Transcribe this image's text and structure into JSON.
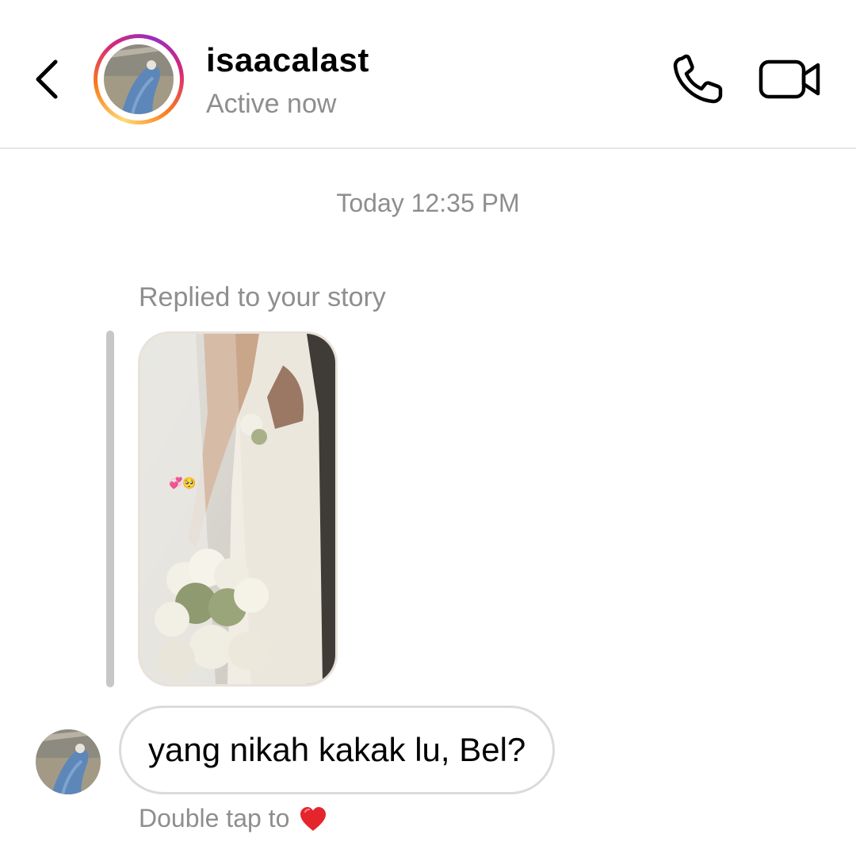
{
  "header": {
    "username": "isaacalast",
    "status": "Active now",
    "back_icon": "chevron-left-icon",
    "call_icon": "phone-icon",
    "video_icon": "video-camera-icon"
  },
  "thread": {
    "timestamp": "Today 12:35 PM",
    "reply_label": "Replied to your story",
    "message": "yang nikah kakak lu, Bel?",
    "double_tap_label": "Double tap to",
    "heart_icon": "red-heart-icon",
    "story_sticker": "💞🥺"
  },
  "colors": {
    "secondary_text": "#8e8e8e",
    "bubble_border": "#dbdbdb",
    "ring_start": "#feda75",
    "ring_end": "#962fbf"
  }
}
